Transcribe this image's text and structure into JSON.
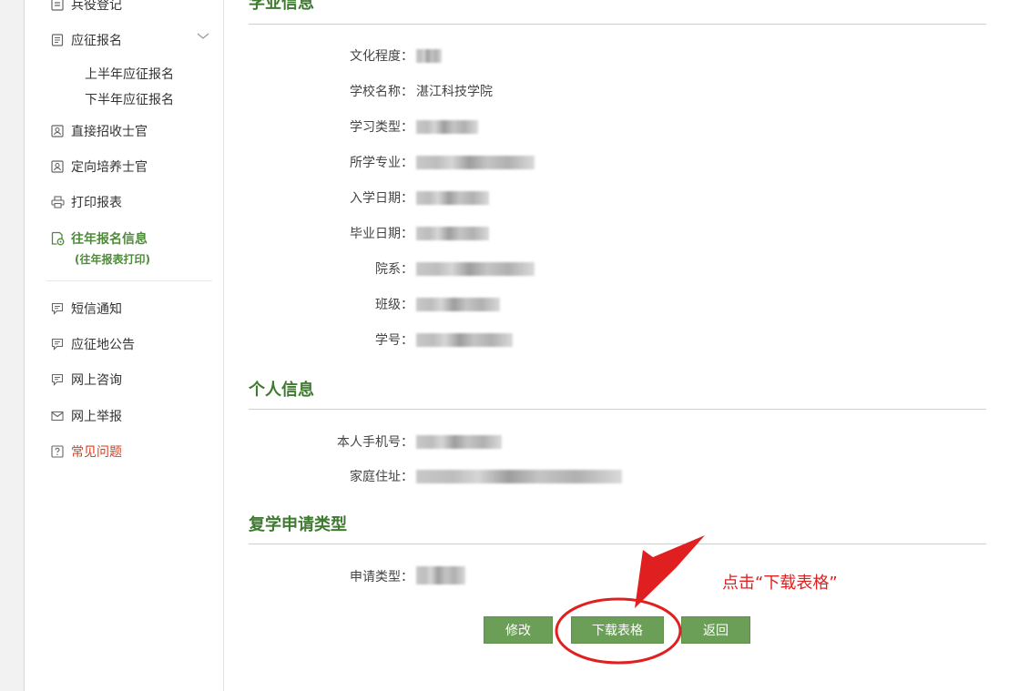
{
  "sidebar": {
    "item_top_cut": "兵役登记",
    "item_enlist": "应征报名",
    "sub_first_half": "上半年应征报名",
    "sub_second_half": "下半年应征报名",
    "item_direct_nco": "直接招收士官",
    "item_oriented_nco": "定向培养士官",
    "item_print": "打印报表",
    "item_past": "往年报名信息",
    "item_past_hint": "(往年报表打印)",
    "item_sms": "短信通知",
    "item_notice": "应征地公告",
    "item_consult": "网上咨询",
    "item_report": "网上举报",
    "item_faq": "常见问题"
  },
  "sections": {
    "education_title": "学业信息",
    "personal_title": "个人信息",
    "resume_title": "复学申请类型"
  },
  "education": {
    "degree_label": "文化程度：",
    "school_label": "学校名称：",
    "school_value": "湛江科技学院",
    "study_type_label": "学习类型：",
    "major_label": "所学专业：",
    "enroll_label": "入学日期：",
    "graduate_label": "毕业日期：",
    "dept_label": "院系：",
    "class_label": "班级：",
    "student_id_label": "学号："
  },
  "personal": {
    "phone_label": "本人手机号：",
    "address_label": "家庭住址："
  },
  "resume": {
    "apply_type_label": "申请类型："
  },
  "buttons": {
    "edit": "修改",
    "download": "下载表格",
    "back": "返回"
  },
  "annotation": {
    "text": "点击“下载表格”"
  },
  "colors": {
    "brand_green": "#3e7a2f",
    "button_green": "#6b9e57",
    "annotation_red": "#e02020",
    "faq_red": "#d6401e"
  }
}
